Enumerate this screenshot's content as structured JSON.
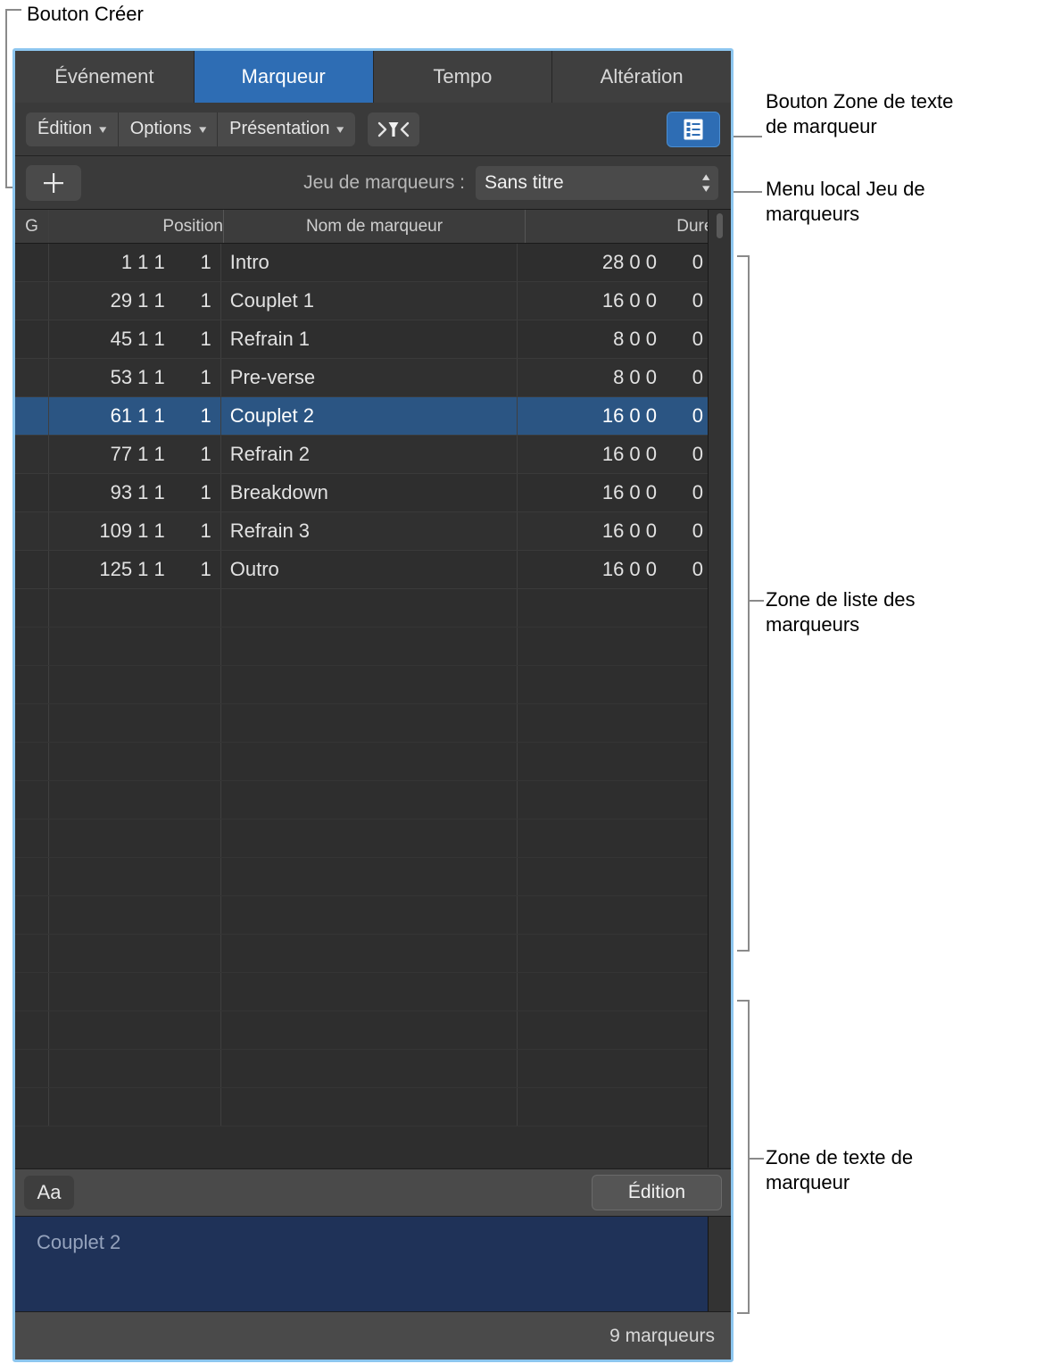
{
  "callouts": {
    "create_button": "Bouton Créer",
    "marker_text_area_button": "Bouton Zone de texte\nde marqueur",
    "marker_set_popup": "Menu local Jeu de\nmarqueurs",
    "marker_list_area": "Zone de liste des\nmarqueurs",
    "marker_text_area": "Zone de texte de\nmarqueur"
  },
  "tabs": [
    {
      "label": "Événement",
      "active": false
    },
    {
      "label": "Marqueur",
      "active": true
    },
    {
      "label": "Tempo",
      "active": false
    },
    {
      "label": "Altération",
      "active": false
    }
  ],
  "toolbar": {
    "menus": [
      {
        "label": "Édition",
        "chevron": "chevron-down-icon"
      },
      {
        "label": "Options",
        "chevron": "chevron-down-icon"
      },
      {
        "label": "Présentation",
        "chevron": "chevron-down-icon"
      }
    ],
    "filter_icon": "funnel-filter-icon",
    "list_view_icon": "list-view-icon"
  },
  "marker_set": {
    "add_button_icon": "plus-icon",
    "label": "Jeu de marqueurs :",
    "selected": "Sans titre",
    "stepper_icon": "up-down-chevron-icon"
  },
  "table": {
    "columns": [
      "G",
      "Position",
      "Nom de marqueur",
      "Durée",
      ""
    ],
    "rows": [
      {
        "g": "",
        "pos_bars": "1 1 1",
        "pos_tick": "1",
        "name": "Intro",
        "dur_bars": "28 0 0",
        "dur_tick": "0",
        "selected": false
      },
      {
        "g": "",
        "pos_bars": "29 1 1",
        "pos_tick": "1",
        "name": "Couplet 1",
        "dur_bars": "16 0 0",
        "dur_tick": "0",
        "selected": false
      },
      {
        "g": "",
        "pos_bars": "45 1 1",
        "pos_tick": "1",
        "name": "Refrain 1",
        "dur_bars": "8 0 0",
        "dur_tick": "0",
        "selected": false
      },
      {
        "g": "",
        "pos_bars": "53 1 1",
        "pos_tick": "1",
        "name": "Pre-verse",
        "dur_bars": "8 0 0",
        "dur_tick": "0",
        "selected": false
      },
      {
        "g": "",
        "pos_bars": "61 1 1",
        "pos_tick": "1",
        "name": "Couplet 2",
        "dur_bars": "16 0 0",
        "dur_tick": "0",
        "selected": true
      },
      {
        "g": "",
        "pos_bars": "77 1 1",
        "pos_tick": "1",
        "name": "Refrain 2",
        "dur_bars": "16 0 0",
        "dur_tick": "0",
        "selected": false
      },
      {
        "g": "",
        "pos_bars": "93 1 1",
        "pos_tick": "1",
        "name": "Breakdown",
        "dur_bars": "16 0 0",
        "dur_tick": "0",
        "selected": false
      },
      {
        "g": "",
        "pos_bars": "109 1 1",
        "pos_tick": "1",
        "name": "Refrain 3",
        "dur_bars": "16 0 0",
        "dur_tick": "0",
        "selected": false
      },
      {
        "g": "",
        "pos_bars": "125 1 1",
        "pos_tick": "1",
        "name": "Outro",
        "dur_bars": "16 0 0",
        "dur_tick": "0",
        "selected": false
      }
    ],
    "empty_rows": 14
  },
  "text_area_toolbar": {
    "font_button": "Aa",
    "edit_button": "Édition"
  },
  "text_area": {
    "content": "Couplet 2"
  },
  "status": {
    "count_label": "9 marqueurs"
  },
  "colors": {
    "accent_blue": "#2e6db4",
    "selection_blue": "#2b5583",
    "text_area_blue": "#1f3258",
    "window_border": "#8dc6ef"
  }
}
